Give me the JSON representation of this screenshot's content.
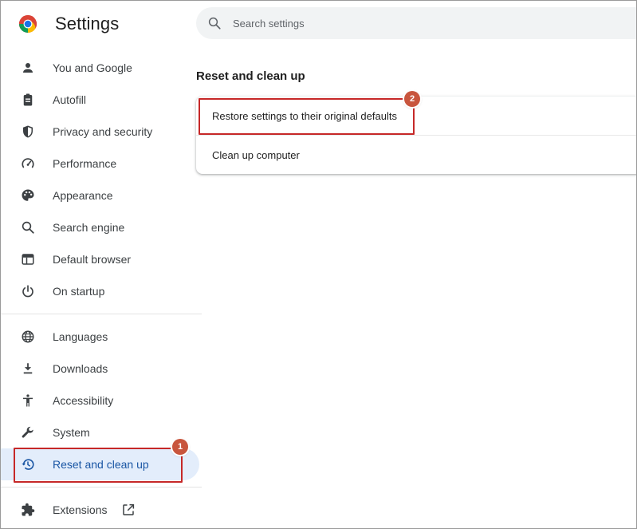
{
  "app": {
    "title": "Settings",
    "logo_icon": "chrome-logo-icon"
  },
  "search": {
    "placeholder": "Search settings",
    "value": ""
  },
  "sidebar": {
    "items": [
      {
        "label": "You and Google",
        "icon": "person-icon"
      },
      {
        "label": "Autofill",
        "icon": "clipboard-icon"
      },
      {
        "label": "Privacy and security",
        "icon": "shield-icon"
      },
      {
        "label": "Performance",
        "icon": "speedometer-icon"
      },
      {
        "label": "Appearance",
        "icon": "palette-icon"
      },
      {
        "label": "Search engine",
        "icon": "search-icon"
      },
      {
        "label": "Default browser",
        "icon": "browser-window-icon"
      },
      {
        "label": "On startup",
        "icon": "power-icon"
      },
      {
        "label": "Languages",
        "icon": "globe-icon"
      },
      {
        "label": "Downloads",
        "icon": "download-icon"
      },
      {
        "label": "Accessibility",
        "icon": "accessibility-icon"
      },
      {
        "label": "System",
        "icon": "wrench-icon"
      },
      {
        "label": "Reset and clean up",
        "icon": "history-reset-icon",
        "active": true
      },
      {
        "label": "Extensions",
        "icon": "puzzle-icon",
        "trailing_icon": "external-link-icon"
      }
    ]
  },
  "main": {
    "section_title": "Reset and clean up",
    "rows": [
      {
        "label": "Restore settings to their original defaults"
      },
      {
        "label": "Clean up computer"
      }
    ]
  },
  "annotations": [
    {
      "number": "1",
      "target": "Reset and clean up"
    },
    {
      "number": "2",
      "target": "Restore settings to their original defaults"
    }
  ],
  "colors": {
    "active_bg": "#e3edfb",
    "active_text": "#1a56a4",
    "annotation_border": "#c62828",
    "badge_bg": "#c8553d",
    "search_bg": "#f1f3f4"
  }
}
